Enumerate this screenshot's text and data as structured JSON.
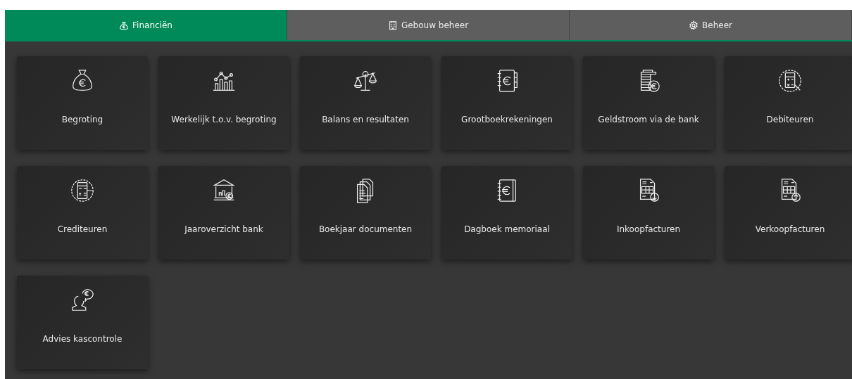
{
  "tabs": [
    {
      "label": "Financiën",
      "selected": true
    },
    {
      "label": "Gebouw beheer",
      "selected": false
    },
    {
      "label": "Beheer",
      "selected": false
    }
  ],
  "tiles": [
    {
      "label": "Begroting"
    },
    {
      "label": "Werkelijk t.o.v. begroting"
    },
    {
      "label": "Balans en resultaten"
    },
    {
      "label": "Grootboekrekeningen"
    },
    {
      "label": "Geldstroom via de bank"
    },
    {
      "label": "Debiteuren"
    },
    {
      "label": "Crediteuren"
    },
    {
      "label": "Jaaroverzicht bank"
    },
    {
      "label": "Boekjaar documenten"
    },
    {
      "label": "Dagboek memoriaal"
    },
    {
      "label": "Inkoopfacturen"
    },
    {
      "label": "Verkoopfacturen"
    },
    {
      "label": "Advies kascontrole"
    }
  ]
}
